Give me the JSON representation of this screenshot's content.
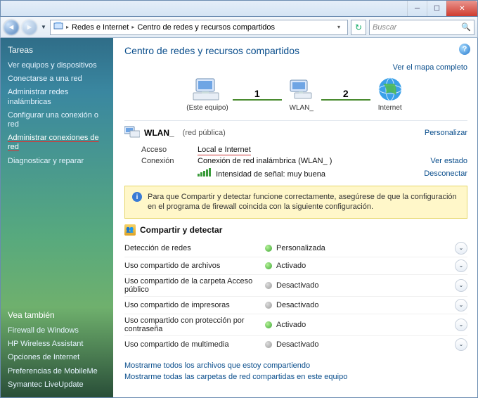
{
  "titlebar": {
    "min": "─",
    "max": "☐",
    "close": "✕"
  },
  "toolbar": {
    "back": "◄",
    "fwd": "►",
    "hist": "▼",
    "breadcrumb": [
      "Redes e Internet",
      "Centro de redes y recursos compartidos"
    ],
    "chev": "▸",
    "refresh": "↻",
    "search_placeholder": "Buscar",
    "mag": "🔍"
  },
  "sidebar": {
    "heading": "Tareas",
    "items": [
      "Ver equipos y dispositivos",
      "Conectarse a una red",
      "Administrar redes inalámbricas",
      "Configurar una conexión o red",
      "Administrar conexiones de red",
      "Diagnosticar y reparar"
    ],
    "vea": "Vea también",
    "sub": [
      "Firewall de Windows",
      "HP Wireless Assistant",
      "Opciones de Internet",
      "Preferencias de MobileMe",
      "Symantec LiveUpdate"
    ]
  },
  "page": {
    "title": "Centro de redes y recursos compartidos",
    "help": "?",
    "mapfull": "Ver el mapa completo",
    "map": {
      "n1_label": "(Este equipo)",
      "edge1": "1",
      "n2_label": "WLAN_",
      "edge2": "2",
      "n3_label": "Internet"
    },
    "net": {
      "name": "WLAN_",
      "type": "(red pública)",
      "personalize": "Personalizar",
      "rows": {
        "acceso_l": "Acceso",
        "acceso_v": "Local e Internet",
        "conex_l": "Conexión",
        "conex_v": "Conexión de red inalámbrica (WLAN_  )",
        "ver_estado": "Ver estado",
        "signal_l": "Intensidad de señal: muy buena",
        "desconectar": "Desconectar"
      }
    },
    "warn": "Para que Compartir y detectar funcione correctamente, asegúrese de que la configuración en el programa de firewall coincida con la siguiente configuración.",
    "sd": {
      "header": "Compartir y detectar",
      "rows": [
        {
          "label": "Detección de redes",
          "state": "Personalizada",
          "on": true
        },
        {
          "label": "Uso compartido de archivos",
          "state": "Activado",
          "on": true
        },
        {
          "label": "Uso compartido de la carpeta Acceso público",
          "state": "Desactivado",
          "on": false
        },
        {
          "label": "Uso compartido de impresoras",
          "state": "Desactivado",
          "on": false
        },
        {
          "label": "Uso compartido con protección por contraseña",
          "state": "Activado",
          "on": true
        },
        {
          "label": "Uso compartido de multimedia",
          "state": "Desactivado",
          "on": false
        }
      ]
    },
    "footer": [
      "Mostrarme todos los archivos que estoy compartiendo",
      "Mostrarme todas las carpetas de red compartidas en este equipo"
    ]
  }
}
